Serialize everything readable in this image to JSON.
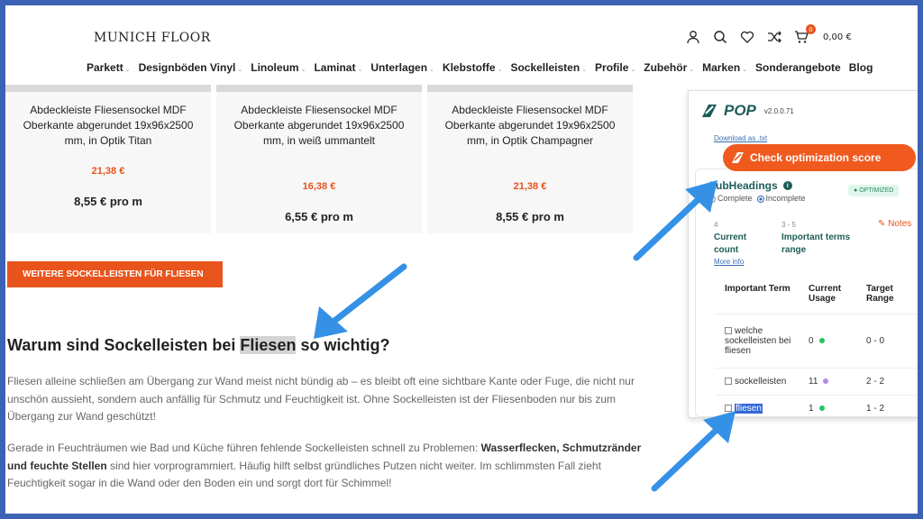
{
  "header": {
    "logo_text": "MUNICH FLOOR",
    "cart_count": "0",
    "cart_total": "0,00 €"
  },
  "nav": [
    {
      "label": "Parkett",
      "caret": true
    },
    {
      "label": "Designböden Vinyl",
      "caret": true
    },
    {
      "label": "Linoleum",
      "caret": true
    },
    {
      "label": "Laminat",
      "caret": true
    },
    {
      "label": "Unterlagen",
      "caret": true
    },
    {
      "label": "Klebstoffe",
      "caret": true
    },
    {
      "label": "Sockelleisten",
      "caret": true
    },
    {
      "label": "Profile",
      "caret": true
    },
    {
      "label": "Zubehör",
      "caret": true
    },
    {
      "label": "Marken",
      "caret": true
    },
    {
      "label": "Sonderangebote",
      "caret": false
    },
    {
      "label": "Blog",
      "caret": false
    }
  ],
  "products": [
    {
      "title": "Abdeckleiste Fliesensockel MDF Oberkante abgerundet 19x96x2500 mm, in Optik Titan",
      "old_price": "21,38 €",
      "unit_price": "8,55 € pro m"
    },
    {
      "title": "Abdeckleiste Fliesensockel MDF Oberkante abgerundet 19x96x2500 mm, in weiß ummantelt",
      "old_price": "16,38 €",
      "unit_price": "6,55 € pro m"
    },
    {
      "title": "Abdeckleiste Fliesensockel MDF Oberkante abgerundet 19x96x2500 mm, in Optik Champagner",
      "old_price": "21,38 €",
      "unit_price": "8,55 € pro m"
    }
  ],
  "more_button": "WEITERE SOCKELLEISTEN FÜR FLIESEN",
  "article": {
    "heading_before": "Warum sind Sockelleisten bei ",
    "heading_highlight": "Fliesen",
    "heading_after": " so wichtig?",
    "para1": "Fliesen alleine schließen am Übergang zur Wand meist nicht bündig ab – es bleibt oft eine sichtbare Kante oder Fuge, die nicht nur unschön aussieht, sondern auch anfällig für Schmutz und Feuchtigkeit ist. Ohne Sockelleisten ist der Fliesenboden nur bis zum Übergang zur Wand geschützt!",
    "para2_a": "Gerade in Feuchträumen wie Bad und Küche führen fehlende Sockelleisten schnell zu Problemen: ",
    "para2_bold": "Wasserflecken, Schmutzränder und feuchte Stellen",
    "para2_b": " sind hier vorprogrammiert. Häufig hilft selbst gründliches Putzen nicht weiter. Im schlimmsten Fall zieht Feuchtigkeit sogar in die Wand oder den Boden ein und sorgt dort für Schimmel!"
  },
  "pop": {
    "name": "POP",
    "version": "v2.0.0.71",
    "download_link": "Download as .txt",
    "check_button": "Check optimization score",
    "section_title": "SubHeadings",
    "status_badge": "OPTIMIZED",
    "radio_complete": "Complete",
    "radio_incomplete": "Incomplete",
    "current_count_value": "4",
    "current_count_label": "Current count",
    "range_value": "3 - 5",
    "range_label": "Important terms range",
    "notes_label": "Notes",
    "more_info": "More info",
    "table": {
      "headers": [
        "Important Term",
        "Current Usage",
        "Target Range"
      ],
      "rows": [
        {
          "term": "welche sockelleisten bei fliesen",
          "usage": "0",
          "dot_color": "#22c55e",
          "target": "0 - 0"
        },
        {
          "term": "sockelleisten",
          "usage": "11",
          "dot_color": "#b58ae6",
          "target": "2 - 2"
        },
        {
          "term": "fliesen",
          "usage": "1",
          "dot_color": "#22c55e",
          "target": "1 - 2"
        }
      ]
    }
  },
  "colors": {
    "accent": "#e8541c",
    "pop_orange": "#f05a1f",
    "pop_teal": "#1e5d58",
    "frame_blue": "#3b62b5",
    "arrow_blue": "#3591e6"
  }
}
